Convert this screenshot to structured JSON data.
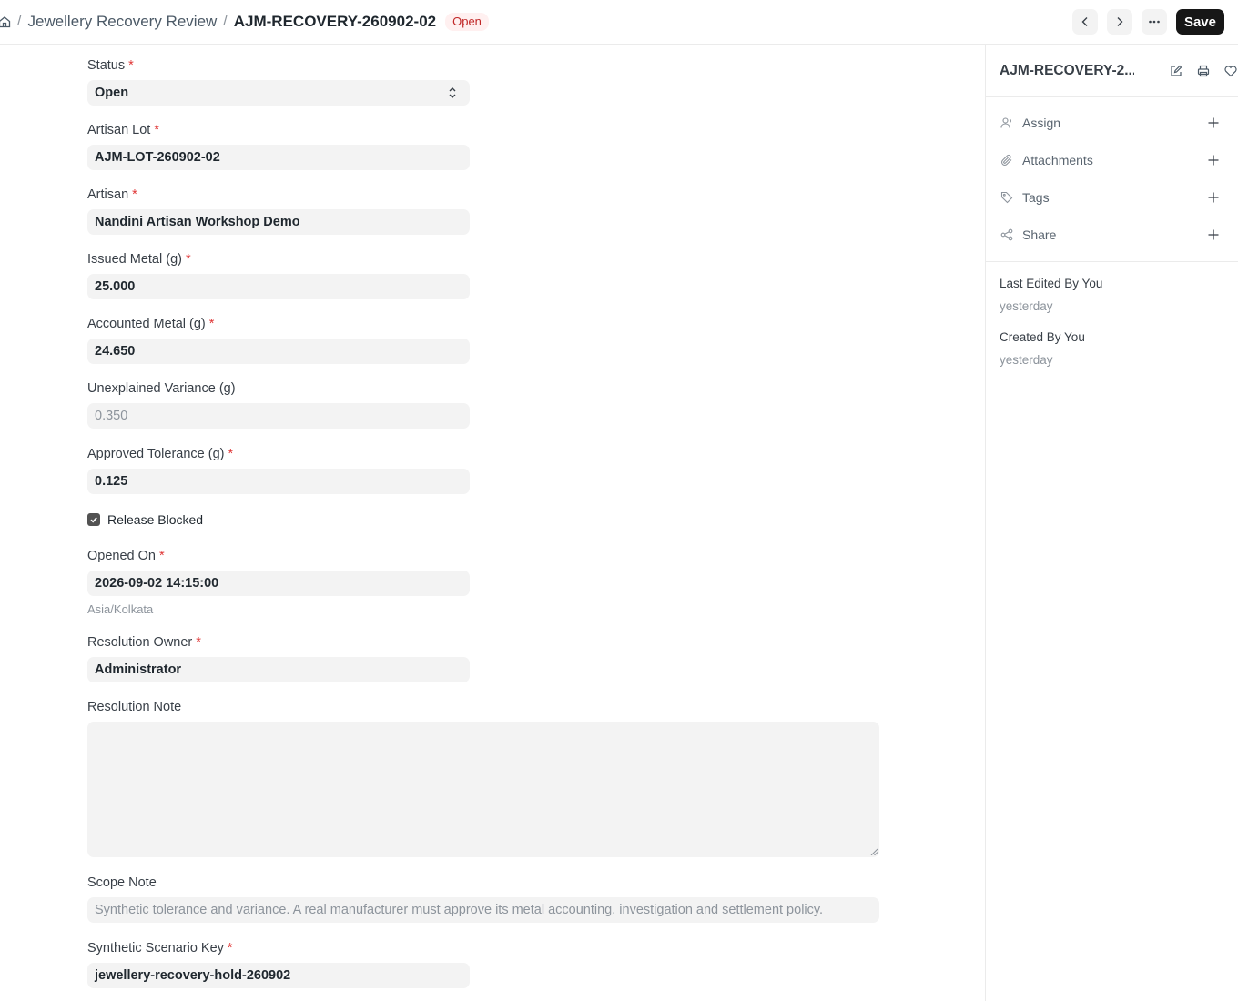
{
  "header": {
    "breadcrumb_doctype": "Jewellery Recovery Review",
    "doc_name": "AJM-RECOVERY-260902-02",
    "status": "Open",
    "save_label": "Save",
    "separator": "/"
  },
  "form": {
    "status": {
      "label": "Status",
      "value": "Open"
    },
    "artisan_lot": {
      "label": "Artisan Lot",
      "value": "AJM-LOT-260902-02"
    },
    "artisan": {
      "label": "Artisan",
      "value": "Nandini Artisan Workshop Demo"
    },
    "issued_metal": {
      "label": "Issued Metal (g)",
      "value": "25.000"
    },
    "accounted_metal": {
      "label": "Accounted Metal (g)",
      "value": "24.650"
    },
    "unexplained_variance": {
      "label": "Unexplained Variance (g)",
      "value": "0.350"
    },
    "approved_tolerance": {
      "label": "Approved Tolerance (g)",
      "value": "0.125"
    },
    "release_blocked": {
      "label": "Release Blocked",
      "checked": true
    },
    "opened_on": {
      "label": "Opened On",
      "value": "2026-09-02 14:15:00",
      "timezone": "Asia/Kolkata"
    },
    "resolution_owner": {
      "label": "Resolution Owner",
      "value": "Administrator"
    },
    "resolution_note": {
      "label": "Resolution Note",
      "value": ""
    },
    "scope_note": {
      "label": "Scope Note",
      "value": "Synthetic tolerance and variance. A real manufacturer must approve its metal accounting, investigation and settlement policy."
    },
    "scenario_key": {
      "label": "Synthetic Scenario Key",
      "value": "jewellery-recovery-hold-260902"
    },
    "required_marker": "*"
  },
  "sidebar": {
    "title": "AJM-RECOVERY-2...",
    "items": [
      {
        "label": "Assign",
        "icon": "user-icon"
      },
      {
        "label": "Attachments",
        "icon": "paperclip-icon"
      },
      {
        "label": "Tags",
        "icon": "tag-icon"
      },
      {
        "label": "Share",
        "icon": "share-icon"
      }
    ],
    "last_edited_label": "Last Edited By You",
    "last_edited_value": "yesterday",
    "created_label": "Created By You",
    "created_value": "yesterday"
  }
}
